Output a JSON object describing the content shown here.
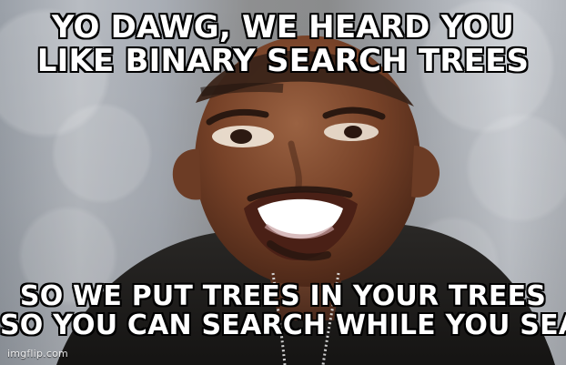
{
  "meme": {
    "top_text_lines": [
      "YO DAWG, WE HEARD YOU",
      "LIKE BINARY SEARCH TREES"
    ],
    "bottom_text_lines": [
      "SO WE PUT TREES IN YOUR TREES",
      "SO YOU CAN SEARCH WHILE YOU SEARCH"
    ],
    "watermark": "imgflip.com"
  },
  "colors": {
    "text": "#ffffff",
    "outline": "#000000",
    "background_gray": "#a8adb4",
    "shirt": "#1d1c1b",
    "skin": "#7b4a2f"
  }
}
